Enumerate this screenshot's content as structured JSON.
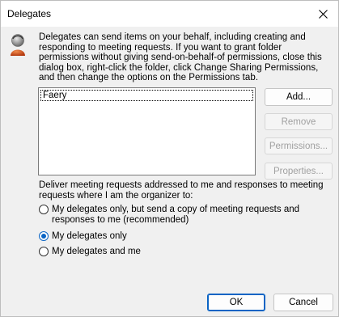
{
  "window": {
    "title": "Delegates"
  },
  "description": "Delegates can send items on your behalf, including creating and responding to meeting requests. If you want to grant folder permissions without giving send-on-behalf-of permissions, close this dialog box, right-click the folder, click Change Sharing Permissions, and then change the options on the Permissions tab.",
  "delegates": [
    "Faery"
  ],
  "buttons": {
    "add": "Add...",
    "remove": "Remove",
    "permissions": "Permissions...",
    "properties": "Properties...",
    "ok": "OK",
    "cancel": "Cancel"
  },
  "deliver_label": "Deliver meeting requests addressed to me and responses to meeting requests where I am the organizer to:",
  "options": [
    {
      "label": "My delegates only, but send a copy of meeting requests and responses to me (recommended)",
      "checked": false
    },
    {
      "label": "My delegates only",
      "checked": true
    },
    {
      "label": "My delegates and me",
      "checked": false
    }
  ],
  "colors": {
    "accent": "#0a64c4",
    "background": "#f0f0f0"
  },
  "icons": {
    "close": "close-icon",
    "user": "user-icon"
  }
}
